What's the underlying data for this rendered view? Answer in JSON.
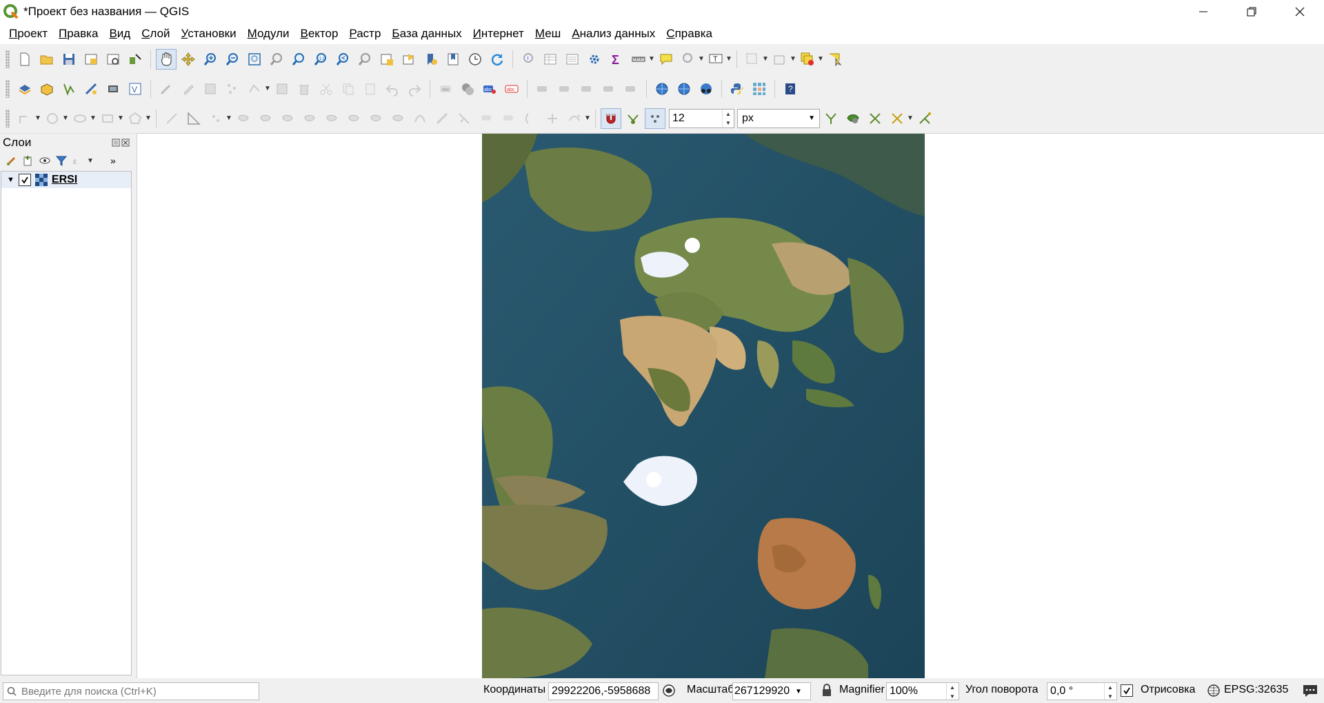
{
  "window": {
    "title": "*Проект без названия — QGIS",
    "controls": [
      "minimize-icon",
      "restore-icon",
      "close-icon"
    ]
  },
  "menu": [
    {
      "label": "Проект",
      "key": "П",
      "rest": "роект"
    },
    {
      "label": "Правка",
      "key": "П",
      "rest": "равка"
    },
    {
      "label": "Вид",
      "key": "В",
      "rest": "ид"
    },
    {
      "label": "Слой",
      "key": "С",
      "rest": "лой"
    },
    {
      "label": "Установки",
      "key": "У",
      "rest": "становки"
    },
    {
      "label": "Модули",
      "key": "М",
      "rest": "одули"
    },
    {
      "label": "Вектор",
      "key": "В",
      "rest": "ектор"
    },
    {
      "label": "Растр",
      "key": "Р",
      "rest": "астр"
    },
    {
      "label": "База данных",
      "key": "Б",
      "rest": "аза данных"
    },
    {
      "label": "Интернет",
      "key": "И",
      "rest": "нтернет"
    },
    {
      "label": "Меш",
      "key": "М",
      "rest": "еш"
    },
    {
      "label": "Анализ данных",
      "key": "А",
      "rest": "нализ данных"
    },
    {
      "label": "Справка",
      "key": "С",
      "rest": "правка"
    }
  ],
  "snapping": {
    "tolerance": "12",
    "unit": "px"
  },
  "layers_panel": {
    "title": "Слои",
    "layers": [
      {
        "name": "ERSI",
        "visible": true
      }
    ]
  },
  "status": {
    "search_placeholder": "Введите для поиска (Ctrl+K)",
    "coords_label": "Координаты",
    "coords_value": "29922206,-5958688",
    "scale_label": "Масштаб",
    "scale_value": "267129920",
    "magnifier_label": "Magnifier",
    "magnifier_value": "100%",
    "rotation_label": "Угол поворота",
    "rotation_value": "0,0 °",
    "render_label": "Отрисовка",
    "crs": "EPSG:32635"
  },
  "colors": {
    "accent": "#2a7ab8",
    "ocean": "#1f4a63",
    "land": "#6b7a3c",
    "desert": "#c9a773",
    "ice": "#eef2fa"
  }
}
